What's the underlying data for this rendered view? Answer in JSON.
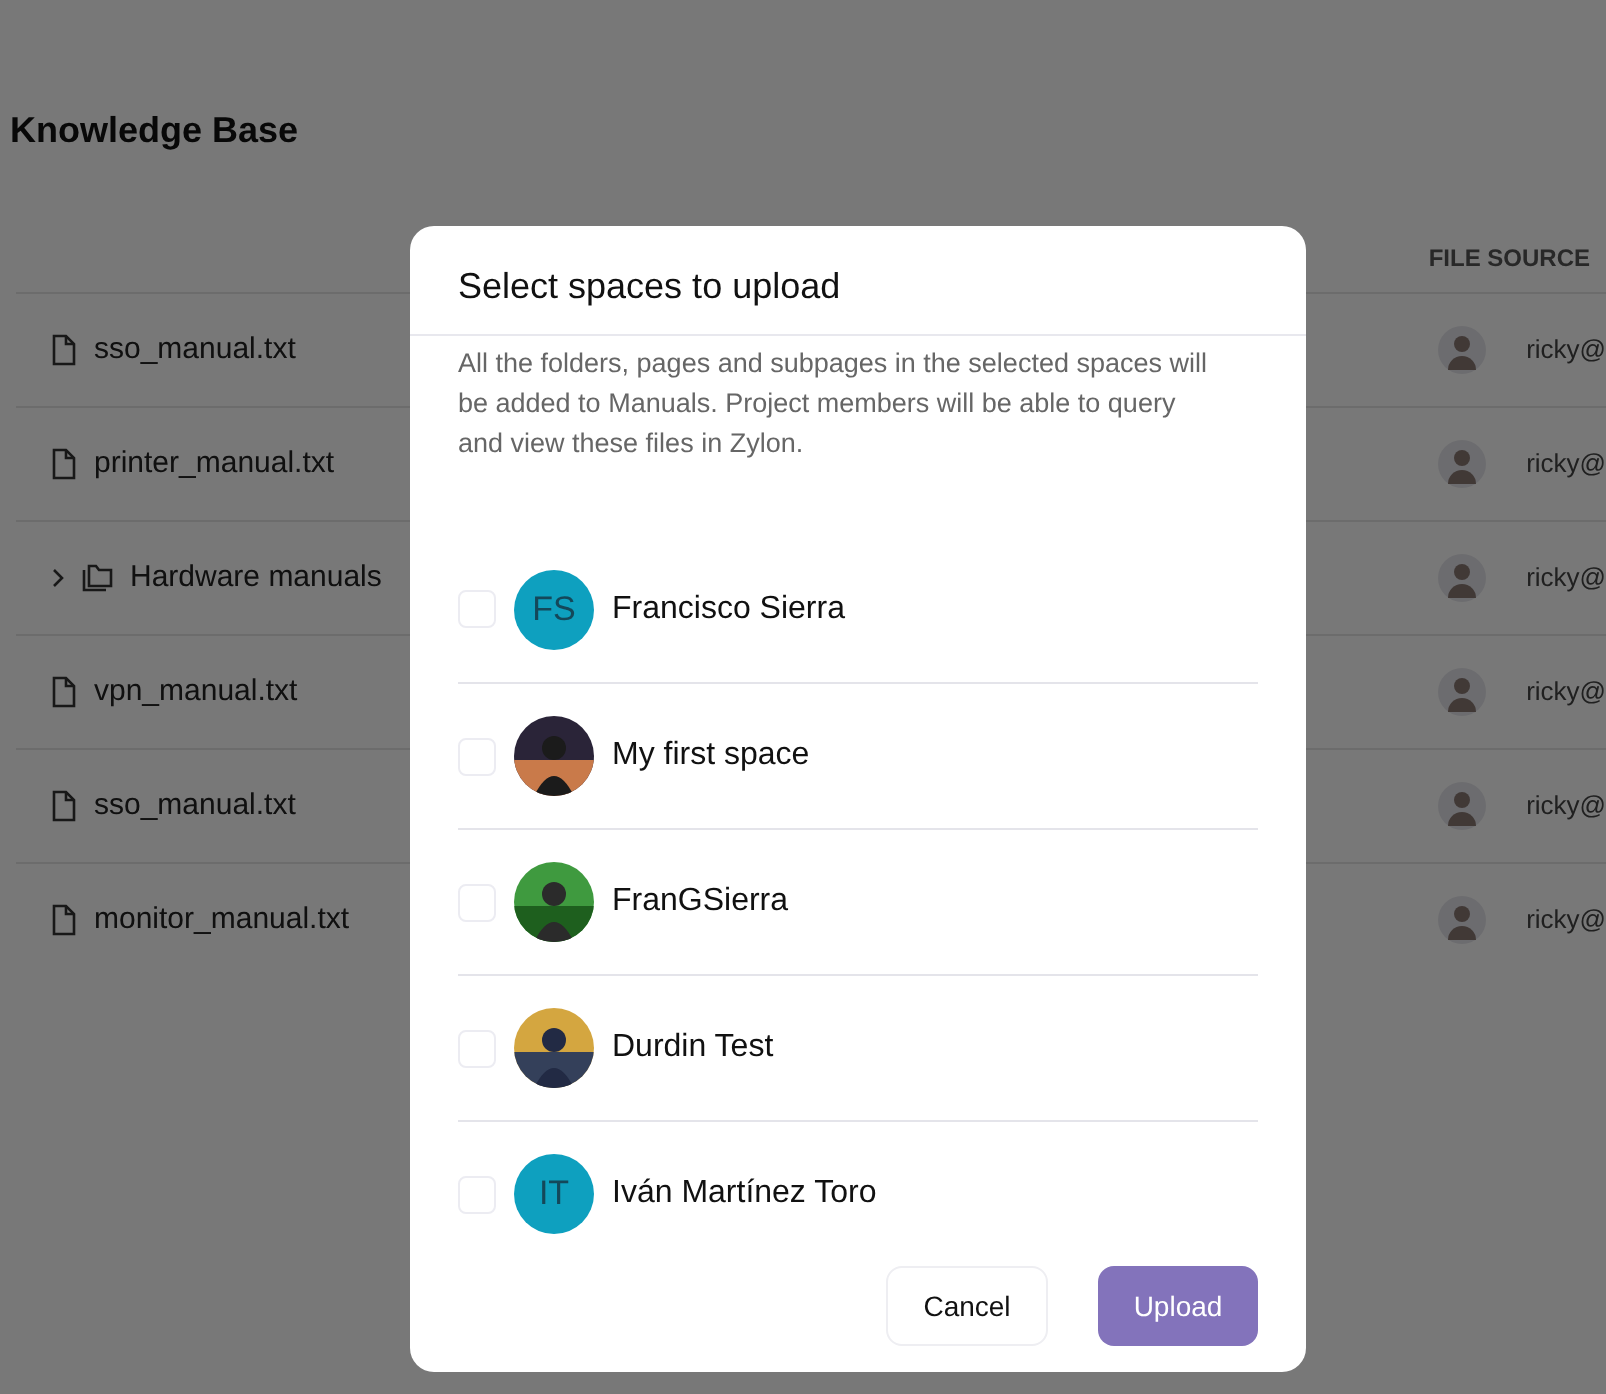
{
  "page": {
    "title": "Knowledge Base"
  },
  "table": {
    "columns": [
      {
        "label": "FILE SOURCE"
      }
    ],
    "rows": [
      {
        "kind": "file",
        "name": "sso_manual.txt",
        "source": "ricky@"
      },
      {
        "kind": "file",
        "name": "printer_manual.txt",
        "source": "ricky@"
      },
      {
        "kind": "folder",
        "name": "Hardware manuals",
        "expanded": false,
        "source": "ricky@"
      },
      {
        "kind": "file",
        "name": "vpn_manual.txt",
        "source": "ricky@"
      },
      {
        "kind": "file",
        "name": "sso_manual.txt",
        "source": "ricky@"
      },
      {
        "kind": "file",
        "name": "monitor_manual.txt",
        "source": "ricky@"
      }
    ]
  },
  "dialog": {
    "title": "Select spaces to upload",
    "description": "All the folders, pages and subpages in the selected spaces will be added to Manuals. Project members will be able to query and view these files in Zylon.",
    "spaces": [
      {
        "name": "Francisco Sierra",
        "checked": false,
        "avatar": {
          "kind": "initials",
          "text": "FS"
        }
      },
      {
        "name": "My first space",
        "checked": false
      },
      {
        "name": "FranGSierra",
        "checked": false
      },
      {
        "name": "Durdin Test",
        "checked": false
      },
      {
        "name": "Iván Martínez Toro",
        "checked": false,
        "avatar": {
          "kind": "initials",
          "text": "IT"
        }
      }
    ],
    "buttons": [
      {
        "kind": "secondary",
        "label": "Cancel"
      },
      {
        "kind": "primary",
        "label": "Upload"
      }
    ]
  }
}
